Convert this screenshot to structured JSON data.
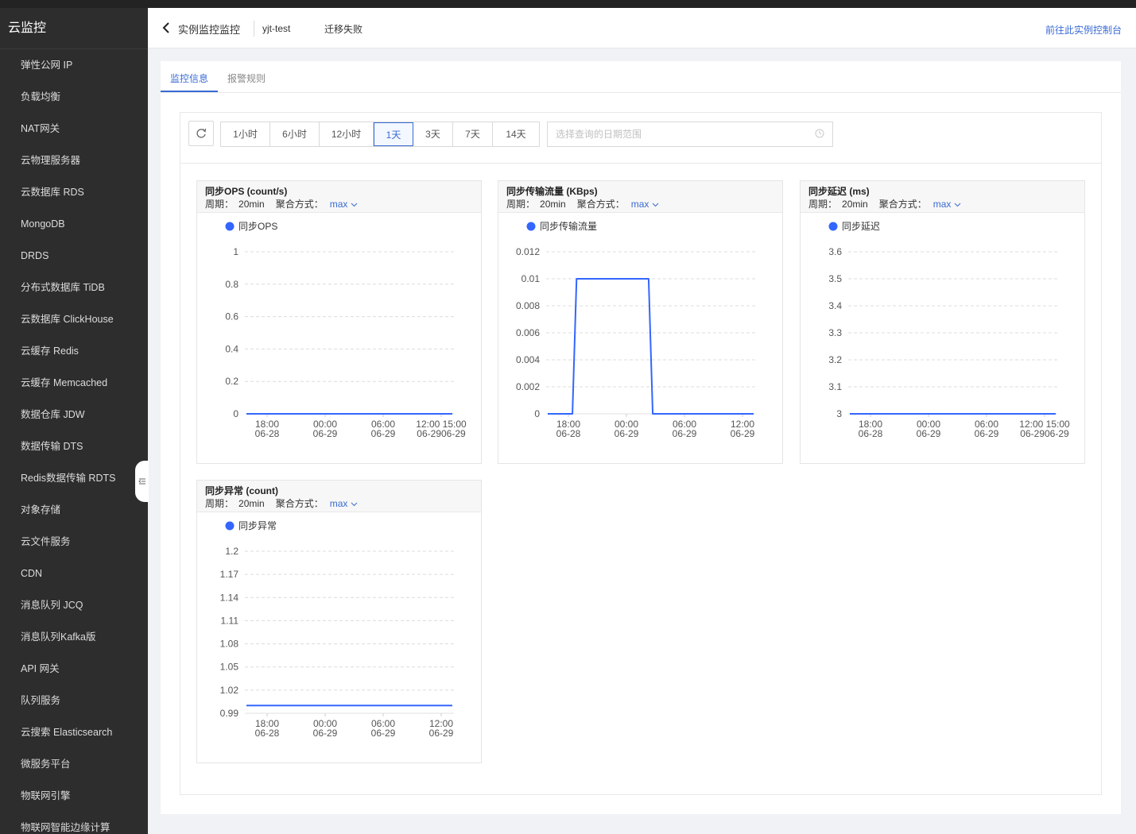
{
  "app": {
    "title": "云监控"
  },
  "sidebar": {
    "items": [
      "弹性公网 IP",
      "负载均衡",
      "NAT网关",
      "云物理服务器",
      "云数据库 RDS",
      "MongoDB",
      "DRDS",
      "分布式数据库 TiDB",
      "云数据库 ClickHouse",
      "云缓存 Redis",
      "云缓存 Memcached",
      "数据仓库 JDW",
      "数据传输 DTS",
      "Redis数据传输 RDTS",
      "对象存储",
      "云文件服务",
      "CDN",
      "消息队列 JCQ",
      "消息队列Kafka版",
      "API 网关",
      "队列服务",
      "云搜索 Elasticsearch",
      "微服务平台",
      "物联网引擎",
      "物联网智能边缘计算"
    ]
  },
  "header": {
    "title": "实例监控监控",
    "instance": "yjt-test",
    "status": "迁移失败",
    "console_link": "前往此实例控制台"
  },
  "tabs": [
    {
      "label": "监控信息",
      "active": true
    },
    {
      "label": "报警规则",
      "active": false
    }
  ],
  "toolbar": {
    "ranges": [
      {
        "label": "1小时",
        "active": false
      },
      {
        "label": "6小时",
        "active": false
      },
      {
        "label": "12小时",
        "active": false
      },
      {
        "label": "1天",
        "active": true
      },
      {
        "label": "3天",
        "active": false
      },
      {
        "label": "7天",
        "active": false
      },
      {
        "label": "14天",
        "active": false
      }
    ],
    "date_placeholder": "选择查询的日期范围"
  },
  "colors": {
    "accent": "#3a6bd5",
    "series": "#3366ff",
    "sidebar_bg": "#2d2d2d"
  },
  "charts": [
    {
      "title": "同步OPS (count/s)",
      "period_label": "周期：",
      "period_value": "20min",
      "agg_label": "聚合方式：",
      "agg_value": "max",
      "chart_data": {
        "type": "line",
        "series": [
          {
            "name": "同步OPS",
            "x": [
              0,
              1
            ],
            "values": [
              0,
              0
            ]
          }
        ],
        "yticks": [
          "1",
          "0.8",
          "0.6",
          "0.4",
          "0.2",
          "0"
        ],
        "ylim": [
          0,
          1
        ],
        "xticks": [
          [
            "18:00",
            "06-28"
          ],
          [
            "00:00",
            "06-29"
          ],
          [
            "06:00",
            "06-29"
          ],
          [
            "12:00 15:00",
            "06-2906-29"
          ]
        ],
        "grid": true,
        "legend": "top-left"
      }
    },
    {
      "title": "同步传输流量 (KBps)",
      "period_label": "周期：",
      "period_value": "20min",
      "agg_label": "聚合方式：",
      "agg_value": "max",
      "chart_data": {
        "type": "line",
        "series": [
          {
            "name": "同步传输流量",
            "x": [
              0,
              0.12,
              0.14,
              0.49,
              0.51,
              1
            ],
            "values": [
              0,
              0,
              0.01,
              0.01,
              0,
              0
            ]
          }
        ],
        "yticks": [
          "0.012",
          "0.01",
          "0.008",
          "0.006",
          "0.004",
          "0.002",
          "0"
        ],
        "ylim": [
          0,
          0.012
        ],
        "xticks": [
          [
            "18:00",
            "06-28"
          ],
          [
            "00:00",
            "06-29"
          ],
          [
            "06:00",
            "06-29"
          ],
          [
            "12:00",
            "06-29"
          ]
        ],
        "grid": true,
        "legend": "top-left"
      }
    },
    {
      "title": "同步延迟 (ms)",
      "period_label": "周期：",
      "period_value": "20min",
      "agg_label": "聚合方式：",
      "agg_value": "max",
      "chart_data": {
        "type": "line",
        "series": [
          {
            "name": "同步延迟",
            "x": [
              0,
              1
            ],
            "values": [
              3,
              3
            ]
          }
        ],
        "yticks": [
          "3.6",
          "3.5",
          "3.4",
          "3.3",
          "3.2",
          "3.1",
          "3"
        ],
        "ylim": [
          3,
          3.6
        ],
        "xticks": [
          [
            "18:00",
            "06-28"
          ],
          [
            "00:00",
            "06-29"
          ],
          [
            "06:00",
            "06-29"
          ],
          [
            "12:00 15:00",
            "06-2906-29"
          ]
        ],
        "grid": true,
        "legend": "top-left"
      }
    },
    {
      "title": "同步异常 (count)",
      "period_label": "周期：",
      "period_value": "20min",
      "agg_label": "聚合方式：",
      "agg_value": "max",
      "chart_data": {
        "type": "line",
        "series": [
          {
            "name": "同步异常",
            "x": [
              0,
              1
            ],
            "values": [
              1,
              1
            ]
          }
        ],
        "yticks": [
          "1.2",
          "1.17",
          "1.14",
          "1.11",
          "1.08",
          "1.05",
          "1.02",
          "0.99"
        ],
        "ylim": [
          0.99,
          1.2
        ],
        "xticks": [
          [
            "18:00",
            "06-28"
          ],
          [
            "00:00",
            "06-29"
          ],
          [
            "06:00",
            "06-29"
          ],
          [
            "12:00",
            "06-29"
          ]
        ],
        "grid": true,
        "legend": "top-left"
      }
    }
  ]
}
